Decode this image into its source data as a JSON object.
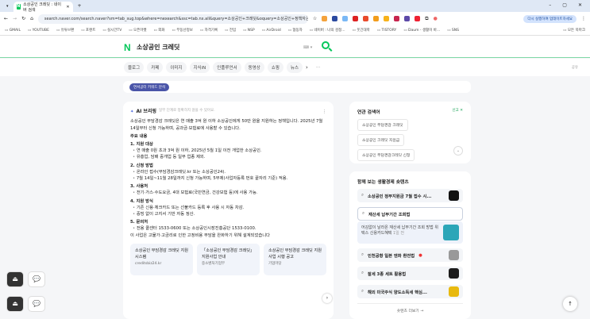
{
  "browser": {
    "tab_title": "소상공인 크레딧 : 네이버 검색",
    "url": "search.naver.com/search.naver?sm=tab_sug.top&where=nexearch&ssc=tab.nx.all&query=소상공인+크레딧&oquery=소상공인+정책자금&tqi=jc7dFlqosK0ssL8...",
    "resume_label": "다시 실행하여 업데이트하세요",
    "bookmarks": [
      "GMAIL",
      "YOUTUBE",
      "유튜브편",
      "포랜트",
      "실시간TV",
      "오픈마켓",
      "외화",
      "부동산정보",
      "자격기록",
      "전입",
      "NSP",
      "AirDroid",
      "협동자",
      "네이버 : 나의 검정...",
      "웃긴대학",
      "TISTORY",
      "Daum - 생활이 바...",
      "SNS",
      "모든 북마크"
    ]
  },
  "header": {
    "logo": "N",
    "query": "소상공인 크레딧",
    "kbd": "⌨ ▾"
  },
  "tabs": [
    "블로그",
    "카페",
    "이미지",
    "지식iN",
    "인플루언서",
    "동영상",
    "쇼핑",
    "뉴스"
  ],
  "share": "공유",
  "keyword_chip": "연서공터 키워드 분석",
  "ai": {
    "title": "AI 브리핑",
    "subtitle": "일부 단계로 정확하지 않을 수 있어요.",
    "intro": "소상공인 부담경감 크레딧은 연 매출 3억 원 이하 소상공인에게 50만 원을 지원하는 정책입니다. 2025년 7월 14일부터 신청 가능하며, 공과금·보험료에 사용할 수 있습니다.",
    "main_heading": "주요 내용",
    "sections": [
      {
        "title": "1. 지원 대상",
        "items": [
          "연 매출 0원 초과 3억 원 이하, 2025년 5월 1일 이전 개업한 소상공인.",
          "유흥업, 담배 중개업 등 일부 업종 제외."
        ]
      },
      {
        "title": "2. 신청 방법",
        "items": [
          "온라인 접수(부담경감크레딧.kr 또는 소상공인24).",
          "7월 14일~11월 28일까지 신청 가능하며, 5부제(사업자등록 번호 끝자리 기준) 적용."
        ]
      },
      {
        "title": "3. 사용처",
        "items": [
          "전기·가스·수도요금, 4대 보험료(국민연금, 건강보험 등)에 사용 가능."
        ]
      },
      {
        "title": "4. 지원 방식",
        "items": [
          "기존 신용·체크카드 또는 선불카드 등록 후 사용 시 자동 차감.",
          "증빙 없이 고지서 기반 자동 정산."
        ]
      },
      {
        "title": "5. 문의처",
        "items": [
          "전용 콜센터 1533-0600 또는 소상공인시장진흥공단 1533-0100."
        ]
      }
    ],
    "outro": "이 사업은 고물가·고금리로 인한 고정비용 부담을 완화하기 위해 설계되었습니다",
    "cards": [
      {
        "title": "소상공인 부담경감 크레딧 지원시스템",
        "source": "creditsbiz24.kr"
      },
      {
        "title": "「소상공인 부담경감 크레딧」 지원사업 안내",
        "source": "중소벤처기업부"
      },
      {
        "title": "소상공인 부담경감 크레딧 지원사업 시행 공고",
        "source": "기업마당"
      }
    ]
  },
  "related": {
    "title": "연관 검색어",
    "close": "신고 ✕",
    "items": [
      "소상공인 부담경감 크레딧",
      "소상공인 크레딧 지원금",
      "소상공인 부담경감크레딧 신청"
    ]
  },
  "trends": {
    "title": "함께 보는 생활경제 숏텐츠",
    "items": [
      "소상공인 정부지원금 7월 접수 시...",
      "재산세 납부기간 조회법",
      "인천공항 일본 엔화 환전법",
      "잘세 3종 세트 활용법",
      "해외 미국주식 양도소득세 핵심..."
    ],
    "expanded": "어김없이 날라온 재산세 납부기간 조회 방법 위택스 신용카드혜택",
    "expanded_time": "1일 전",
    "more": "숏텐츠 더보기 →"
  }
}
